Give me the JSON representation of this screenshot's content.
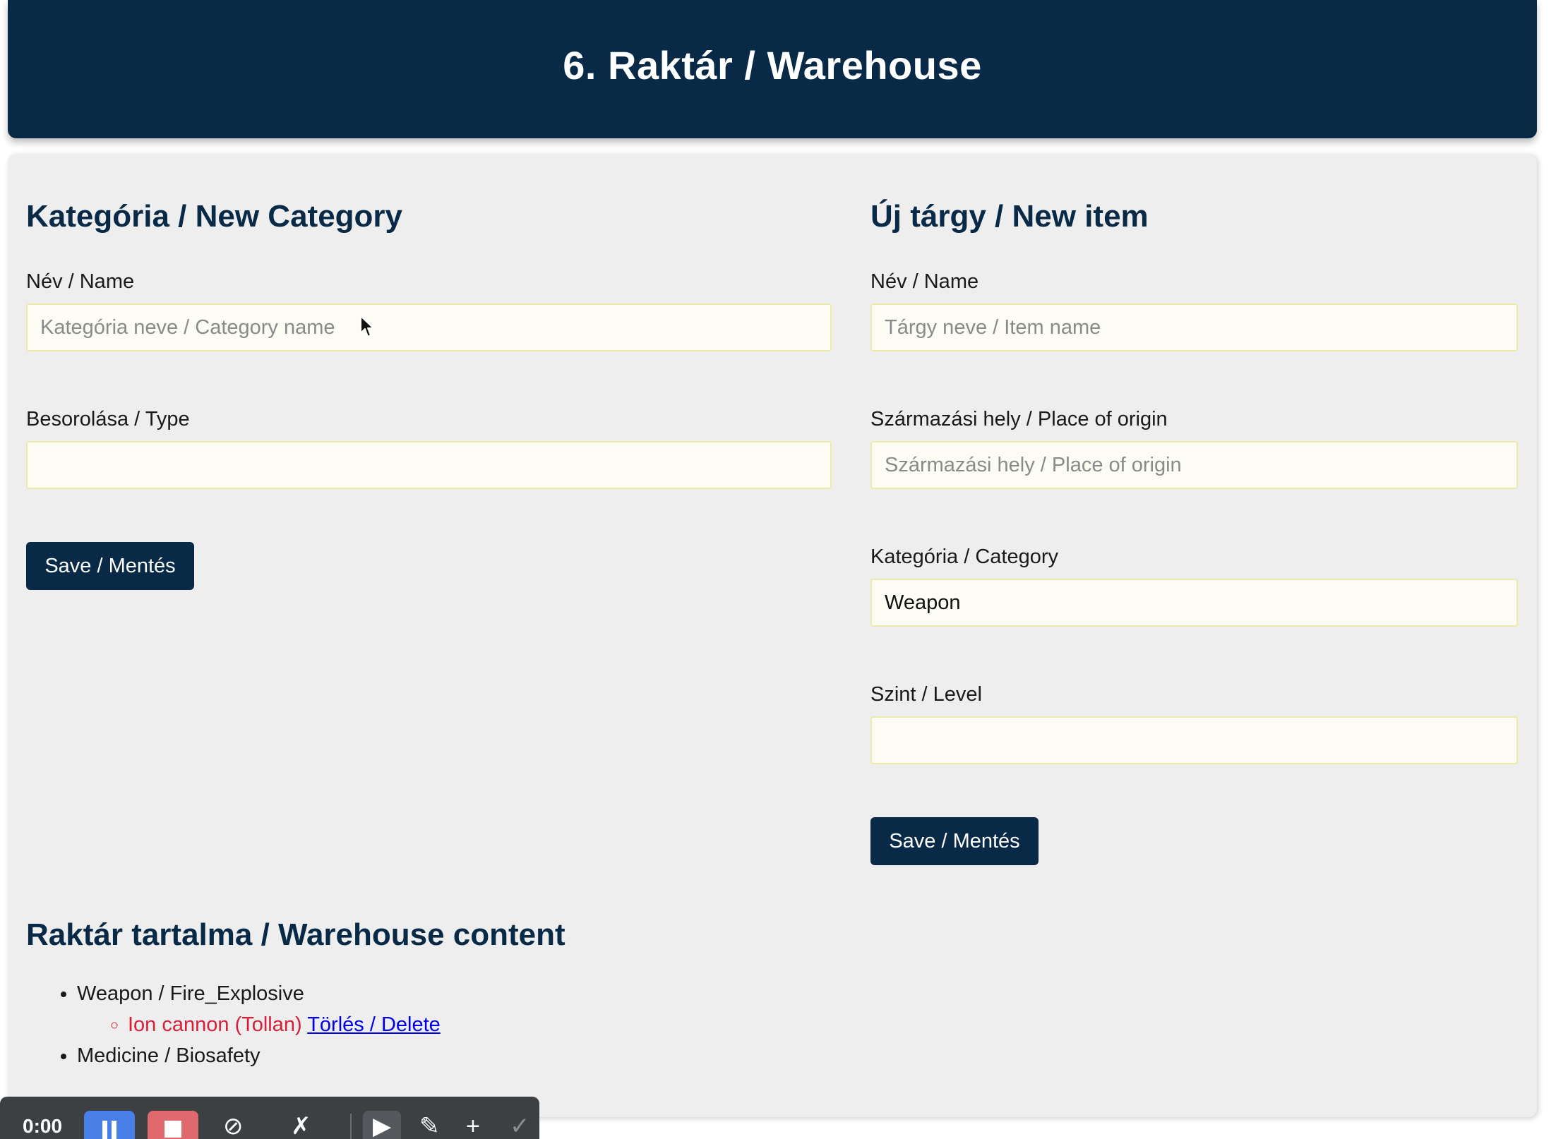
{
  "header": {
    "title": "6. Raktár / Warehouse"
  },
  "category_form": {
    "heading": "Kategória / New Category",
    "name_label": "Név / Name",
    "name_placeholder": "Kategória neve / Category name",
    "name_value": "",
    "type_label": "Besorolása / Type",
    "type_value": "",
    "save_label": "Save / Mentés"
  },
  "item_form": {
    "heading": "Új tárgy / New item",
    "name_label": "Név / Name",
    "name_placeholder": "Tárgy neve / Item name",
    "origin_label": "Származási hely / Place of origin",
    "origin_placeholder": "Származási hely / Place of origin",
    "category_label": "Kategória / Category",
    "category_value": "Weapon",
    "level_label": "Szint / Level",
    "level_value": "",
    "save_label": "Save / Mentés"
  },
  "warehouse": {
    "heading": "Raktár tartalma / Warehouse content",
    "categories": [
      {
        "label": "Weapon / Fire_Explosive",
        "items": [
          {
            "label": "Ion cannon (Tollan)",
            "delete_label": "Törlés / Delete"
          }
        ]
      },
      {
        "label": "Medicine / Biosafety",
        "items": []
      }
    ]
  },
  "recorder_toolbar": {
    "time": "0:00",
    "icons": [
      "pause-icon",
      "stop-icon",
      "mic-off-icon",
      "camera-off-icon",
      "pointer-icon",
      "pen-icon",
      "plus-icon",
      "check-icon"
    ]
  }
}
